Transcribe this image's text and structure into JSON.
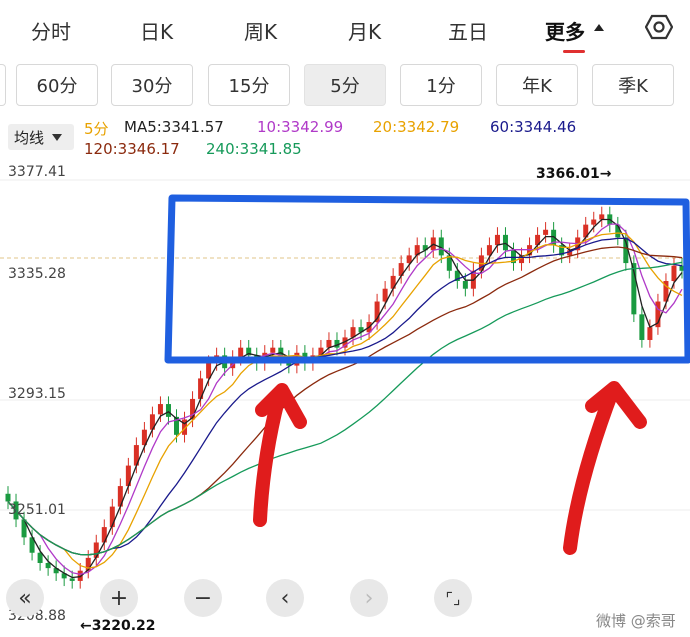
{
  "tabs": [
    {
      "label": "分时"
    },
    {
      "label": "日K"
    },
    {
      "label": "周K"
    },
    {
      "label": "月K"
    },
    {
      "label": "五日"
    },
    {
      "label": "更多"
    }
  ],
  "periods": [
    {
      "label": "60分"
    },
    {
      "label": "30分"
    },
    {
      "label": "15分"
    },
    {
      "label": "5分"
    },
    {
      "label": "1分"
    },
    {
      "label": "年K"
    },
    {
      "label": "季K"
    }
  ],
  "active_period": "5分",
  "ma_selector": {
    "label": "均线"
  },
  "legend": {
    "period": "5分",
    "ma5": "MA5:3341.57",
    "ma10": "10:3342.99",
    "ma20": "20:3342.79",
    "ma60": "60:3344.46",
    "ma120": "120:3346.17",
    "ma240": "240:3341.85"
  },
  "colors": {
    "period": "#e8a200",
    "ma5": "#222222",
    "ma10": "#b03ac8",
    "ma20": "#e8a200",
    "ma60": "#1a1a8c",
    "ma120": "#8b2a0e",
    "ma240": "#169a5a",
    "up": "#d93025",
    "down": "#1a9a40",
    "annotation_box": "#1f5fe0",
    "annotation_arrow": "#e01c1c"
  },
  "y_axis": [
    "3377.41",
    "3335.28",
    "3293.15",
    "3251.01",
    "3208.88"
  ],
  "annotations": {
    "high": "3366.01→",
    "low": "←3220.22"
  },
  "toolbar": {
    "collapse": "«",
    "zoom_in": "+",
    "zoom_out": "−",
    "prev": "‹",
    "next": "›",
    "fullscreen": "⌜⌟"
  },
  "watermark": "微博 @索哥",
  "chart_data": {
    "type": "candlestick",
    "ylim": [
      3208.88,
      3377.41
    ],
    "y_ticks": [
      3377.41,
      3335.28,
      3293.15,
      3251.01,
      3208.88
    ],
    "max": 3366.01,
    "min": 3220.22,
    "close_series": [
      3252,
      3245,
      3238,
      3232,
      3228,
      3226,
      3224,
      3222,
      3221,
      3225,
      3230,
      3236,
      3242,
      3250,
      3258,
      3266,
      3274,
      3280,
      3286,
      3290,
      3285,
      3278,
      3284,
      3292,
      3300,
      3306,
      3309,
      3304,
      3308,
      3312,
      3309,
      3306,
      3310,
      3312,
      3308,
      3305,
      3310,
      3306,
      3309,
      3312,
      3315,
      3312,
      3316,
      3320,
      3318,
      3322,
      3330,
      3335,
      3340,
      3345,
      3348,
      3352,
      3350,
      3355,
      3348,
      3342,
      3338,
      3335,
      3342,
      3348,
      3352,
      3356,
      3350,
      3345,
      3348,
      3352,
      3356,
      3358,
      3352,
      3348,
      3350,
      3355,
      3360,
      3362,
      3364,
      3360,
      3355,
      3345,
      3325,
      3315,
      3320,
      3330,
      3338,
      3344,
      3342
    ]
  }
}
